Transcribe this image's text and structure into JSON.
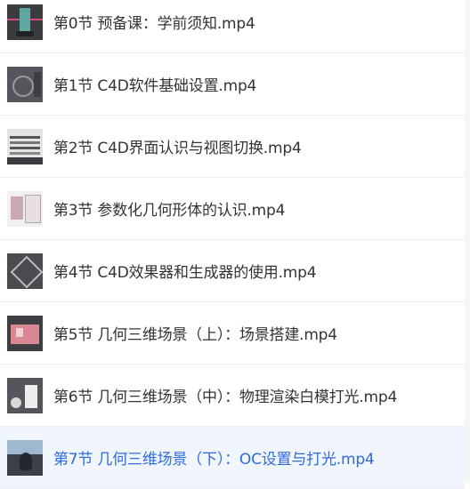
{
  "lessons": [
    {
      "title": "第0节 预备课：学前须知.mp4",
      "thumbnail": "video-thumbnail",
      "active": false
    },
    {
      "title": "第1节 C4D软件基础设置.mp4",
      "thumbnail": "video-thumbnail",
      "active": false
    },
    {
      "title": "第2节 C4D界面认识与视图切换.mp4",
      "thumbnail": "video-thumbnail",
      "active": false
    },
    {
      "title": "第3节 参数化几何形体的认识.mp4",
      "thumbnail": "video-thumbnail",
      "active": false
    },
    {
      "title": "第4节 C4D效果器和生成器的使用.mp4",
      "thumbnail": "video-thumbnail",
      "active": false
    },
    {
      "title": "第5节 几何三维场景（上）：场景搭建.mp4",
      "thumbnail": "video-thumbnail",
      "active": false
    },
    {
      "title": "第6节 几何三维场景（中）：物理渲染白模打光.mp4",
      "thumbnail": "video-thumbnail",
      "active": false
    },
    {
      "title": "第7节 几何三维场景（下）：OC设置与打光.mp4",
      "thumbnail": "video-thumbnail",
      "active": true
    }
  ],
  "colors": {
    "text": "#333333",
    "active_text": "#2f6bde",
    "active_bg": "#f1f5fd",
    "divider": "#eceef2"
  }
}
